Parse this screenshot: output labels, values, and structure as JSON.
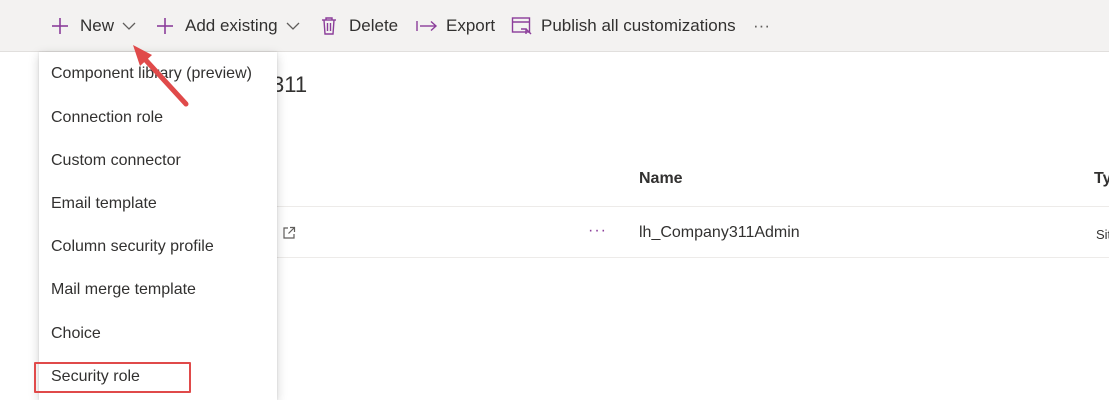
{
  "toolbar": {
    "new_label": "New",
    "add_existing_label": "Add existing",
    "delete_label": "Delete",
    "export_label": "Export",
    "publish_label": "Publish all customizations",
    "more_label": "···"
  },
  "page": {
    "title_visible": "311"
  },
  "table": {
    "columns": [
      {
        "label": "Name"
      },
      {
        "label": "Ty"
      }
    ],
    "rows": [
      {
        "more": "···",
        "name": "lh_Company311Admin",
        "type": "Sit"
      }
    ]
  },
  "new_menu": {
    "items": [
      {
        "label": "Component library (preview)"
      },
      {
        "label": "Connection role"
      },
      {
        "label": "Custom connector"
      },
      {
        "label": "Email template"
      },
      {
        "label": "Column security profile"
      },
      {
        "label": "Mail merge template"
      },
      {
        "label": "Choice"
      },
      {
        "label": "Security role"
      }
    ],
    "highlighted_item": "Security role"
  },
  "colors": {
    "accent": "#8b3d9a",
    "annotation_red": "#e04a4a",
    "toolbar_bg": "#f3f2f1"
  },
  "icons": {
    "new": "plus-icon",
    "add_existing": "plus-icon",
    "delete": "trash-icon",
    "export": "export-arrow-icon",
    "publish": "publish-icon",
    "more": "ellipsis-icon",
    "external": "external-link-icon"
  }
}
